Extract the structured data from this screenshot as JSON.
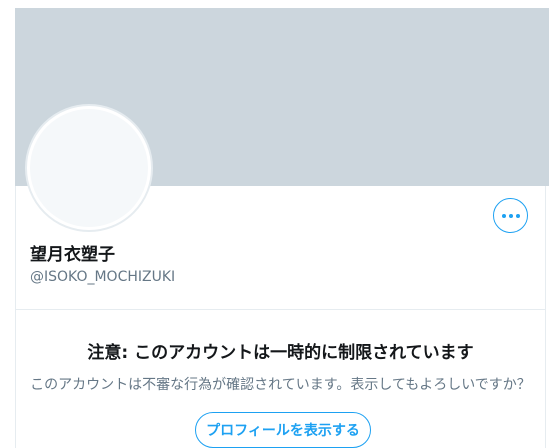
{
  "profile": {
    "display_name": "望月衣塑子",
    "handle": "@ISOKO_MOCHIZUKI"
  },
  "actions": {
    "more_icon": "more-horizontal-icon"
  },
  "warning": {
    "title": "注意: このアカウントは一時的に制限されています",
    "body": "このアカウントは不審な行為が確認されています。表示してもよろしいですか？",
    "button_label": "プロフィールを表示する"
  },
  "colors": {
    "banner": "#ccd6dd",
    "accent": "#1da1f2",
    "secondary_text": "#657786",
    "border": "#e6ecf0"
  }
}
